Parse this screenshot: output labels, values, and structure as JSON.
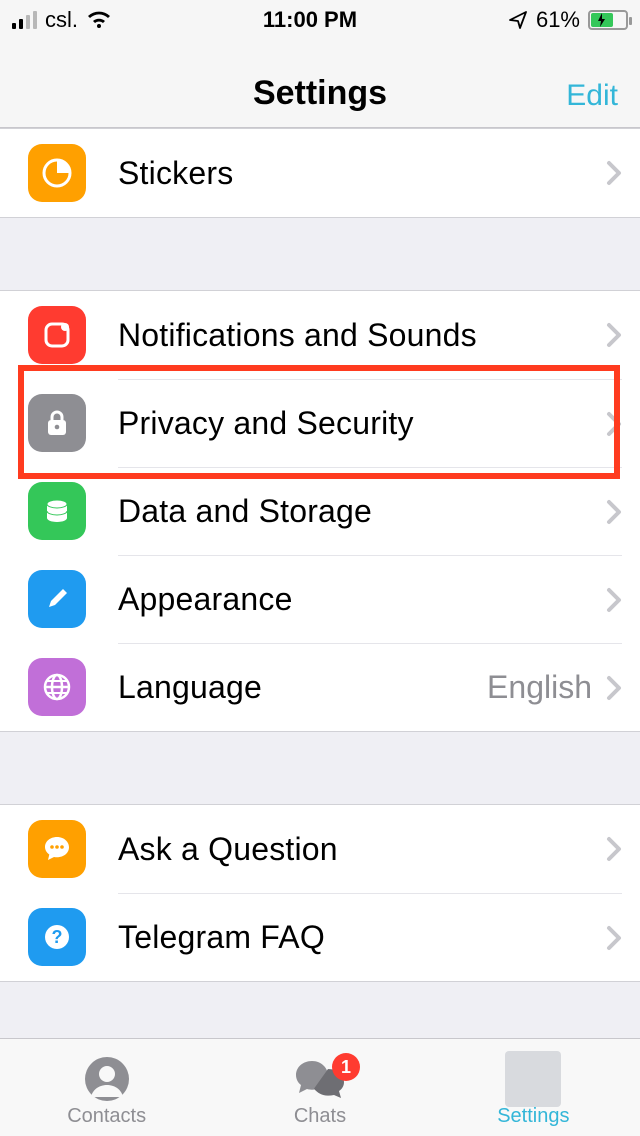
{
  "status": {
    "carrier": "csl.",
    "time": "11:00 PM",
    "battery_pct": "61%"
  },
  "nav": {
    "title": "Settings",
    "edit": "Edit"
  },
  "sections": {
    "stickers": "Stickers",
    "notifications": "Notifications and Sounds",
    "privacy": "Privacy and Security",
    "data": "Data and Storage",
    "appearance": "Appearance",
    "language_label": "Language",
    "language_value": "English",
    "ask": "Ask a Question",
    "faq": "Telegram FAQ"
  },
  "tabs": {
    "contacts": "Contacts",
    "chats": "Chats",
    "chats_badge": "1",
    "settings": "Settings"
  },
  "highlight": {
    "target": "privacy"
  }
}
